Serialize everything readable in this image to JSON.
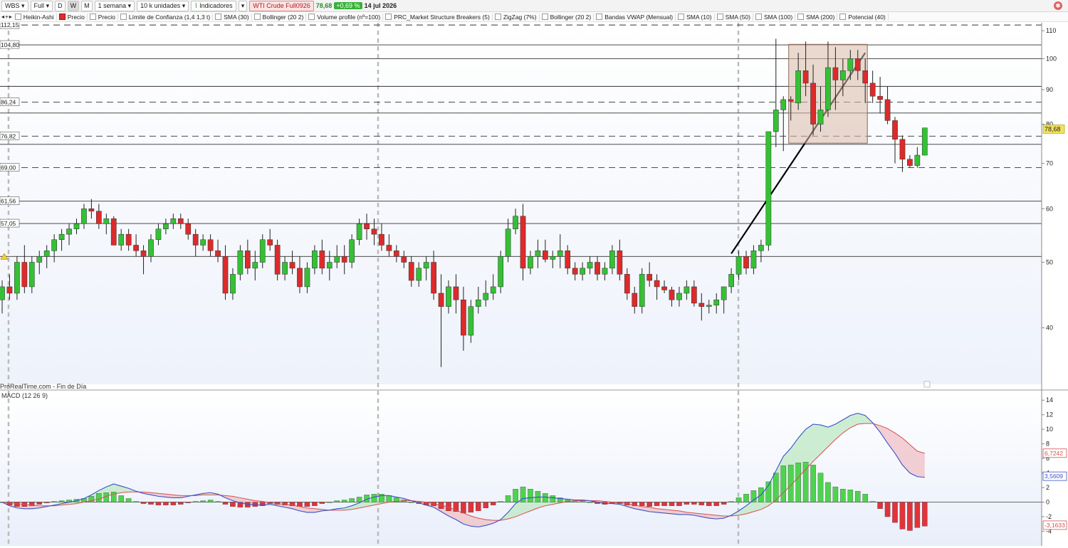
{
  "toolbar": {
    "ticker": "WBS",
    "mode": "Full",
    "periods": [
      "D",
      "W",
      "M"
    ],
    "interval": "1 semana",
    "units": "10 k unidades",
    "indicators": "Indicadores",
    "instrument": "WTI Crude Full0926",
    "price": "78,68",
    "change": "+0,69 %",
    "date": "14 jul 2026"
  },
  "legend": {
    "items": [
      "Heikin-Ashi",
      "Precio",
      "Precio",
      "Límite de Confianza (1,4 1,3 t)",
      "SMA (30)",
      "Bollinger (20 2)",
      "Volume profile (nº=100)",
      "PRC_Market Structure Breakers (5)",
      "ZigZag (7%)",
      "Bollinger (20 2)",
      "Bandas VWAP  (Mensual)",
      "SMA (10)",
      "SMA (50)",
      "SMA (100)",
      "SMA (200)",
      "Potencial (40)"
    ]
  },
  "footer": {
    "source": "ProRealTime.com - Fin de Día"
  },
  "macd_panel": {
    "title": "MACD (12 26 9)"
  },
  "colors": {
    "up": "#35c035",
    "down": "#dd2a2a",
    "macd_line": "#3a52c8",
    "signal_line": "#d65050",
    "level_line": "#333333"
  },
  "chart_data": [
    {
      "type": "candlestick",
      "title": "WTI Crude Full0926",
      "ylim": [
        33,
        113
      ],
      "y_ticks": [
        40,
        50,
        60,
        70,
        80,
        90,
        100,
        110
      ],
      "last_price_label": "78,68",
      "level_labels": [
        "112,15",
        "104,80",
        "86,24",
        "76,82",
        "69,00",
        "61,56",
        "57,05"
      ],
      "levels": [
        {
          "value": 112.15,
          "style": "dashed"
        },
        {
          "value": 104.8,
          "style": "solid"
        },
        {
          "value": 100,
          "style": "solid"
        },
        {
          "value": 91,
          "style": "solid"
        },
        {
          "value": 86.24,
          "style": "dashed"
        },
        {
          "value": 83.1,
          "style": "solid"
        },
        {
          "value": 76.82,
          "style": "dashed"
        },
        {
          "value": 74.7,
          "style": "solid"
        },
        {
          "value": 69.0,
          "style": "dashed"
        },
        {
          "value": 61.56,
          "style": "solid"
        },
        {
          "value": 57.05,
          "style": "solid"
        },
        {
          "value": 51.0,
          "style": "solid"
        }
      ],
      "candles": [
        [
          44,
          47,
          42,
          46
        ],
        [
          46,
          48,
          44,
          45
        ],
        [
          45,
          51,
          44,
          50
        ],
        [
          50,
          53,
          45,
          46
        ],
        [
          46,
          51,
          45,
          50
        ],
        [
          50,
          52,
          48,
          51
        ],
        [
          51,
          53,
          49,
          52
        ],
        [
          52,
          55,
          50,
          54
        ],
        [
          54,
          56,
          52,
          55
        ],
        [
          55,
          57,
          53,
          56
        ],
        [
          56,
          58,
          55,
          57
        ],
        [
          57,
          61,
          56,
          60
        ],
        [
          60,
          62,
          58,
          59.5
        ],
        [
          59.5,
          61,
          56,
          57
        ],
        [
          57,
          59,
          55,
          58
        ],
        [
          58,
          58.5,
          53,
          53
        ],
        [
          53,
          56,
          52,
          55
        ],
        [
          55,
          56,
          52,
          53
        ],
        [
          53,
          55,
          51,
          52
        ],
        [
          52,
          53,
          48,
          51
        ],
        [
          51,
          55,
          50,
          54
        ],
        [
          54,
          57,
          53,
          56
        ],
        [
          56,
          58,
          55,
          57
        ],
        [
          57,
          59,
          56,
          58
        ],
        [
          58,
          59,
          56,
          57
        ],
        [
          57,
          58,
          54,
          55
        ],
        [
          55,
          56,
          51,
          53
        ],
        [
          53,
          55,
          52,
          54
        ],
        [
          54,
          55,
          51,
          52
        ],
        [
          52,
          54,
          50,
          51
        ],
        [
          51,
          53,
          44,
          45
        ],
        [
          45,
          49,
          44,
          48
        ],
        [
          48,
          53,
          47,
          52
        ],
        [
          52,
          54,
          48,
          49
        ],
        [
          49,
          52,
          47,
          50
        ],
        [
          50,
          55,
          49,
          54
        ],
        [
          54,
          56,
          52,
          53
        ],
        [
          53,
          54,
          47,
          48
        ],
        [
          48,
          51,
          47,
          50
        ],
        [
          50,
          52,
          48,
          49
        ],
        [
          49,
          51,
          45,
          46
        ],
        [
          46,
          50,
          45,
          49
        ],
        [
          49,
          53,
          48,
          52
        ],
        [
          52,
          54,
          48,
          49
        ],
        [
          49,
          52,
          47,
          50
        ],
        [
          50,
          53,
          49,
          51
        ],
        [
          51,
          53,
          48,
          50
        ],
        [
          50,
          55,
          49,
          54
        ],
        [
          54,
          58,
          53,
          57
        ],
        [
          57,
          59,
          54,
          56
        ],
        [
          56,
          58,
          53,
          55
        ],
        [
          55,
          57,
          52,
          53
        ],
        [
          53,
          55,
          51,
          52
        ],
        [
          52,
          53,
          50,
          51
        ],
        [
          51,
          52,
          49,
          50
        ],
        [
          50,
          51,
          46,
          47
        ],
        [
          47,
          50,
          46,
          49
        ],
        [
          49,
          51,
          47,
          50
        ],
        [
          50,
          52,
          44,
          45
        ],
        [
          45,
          48,
          35,
          43
        ],
        [
          43,
          47,
          42,
          46
        ],
        [
          46,
          48,
          42,
          44
        ],
        [
          44,
          46,
          37,
          39
        ],
        [
          39,
          44,
          38,
          43
        ],
        [
          43,
          46,
          42,
          44
        ],
        [
          44,
          47,
          43,
          45
        ],
        [
          45,
          48,
          44,
          46
        ],
        [
          46,
          52,
          45,
          51
        ],
        [
          51,
          58,
          50,
          56
        ],
        [
          56,
          60,
          55,
          58.5
        ],
        [
          58.5,
          61,
          47,
          49
        ],
        [
          49,
          52,
          48,
          51
        ],
        [
          51,
          54,
          49,
          52
        ],
        [
          52,
          54,
          50,
          50.5
        ],
        [
          50.5,
          52,
          49,
          51
        ],
        [
          51,
          55,
          49,
          52
        ],
        [
          52,
          53,
          48,
          49
        ],
        [
          49,
          50,
          47,
          48
        ],
        [
          48,
          50,
          47,
          49
        ],
        [
          49,
          51,
          48,
          50
        ],
        [
          50,
          51,
          47,
          48
        ],
        [
          48,
          50,
          47,
          49
        ],
        [
          49,
          53,
          48,
          52
        ],
        [
          52,
          54,
          47,
          48
        ],
        [
          48,
          49,
          44,
          45
        ],
        [
          45,
          46,
          42,
          43
        ],
        [
          43,
          49,
          42,
          48
        ],
        [
          48,
          50,
          46,
          47
        ],
        [
          47,
          48,
          44,
          46
        ],
        [
          46,
          47,
          45,
          45.5
        ],
        [
          45.5,
          46,
          43,
          44
        ],
        [
          44,
          46,
          43,
          45
        ],
        [
          45,
          47,
          44,
          46
        ],
        [
          46,
          47,
          43,
          43.5
        ],
        [
          43.5,
          45,
          41,
          43
        ],
        [
          43,
          44,
          42,
          43.2
        ],
        [
          43.2,
          45,
          42,
          44
        ],
        [
          44,
          46,
          42,
          46
        ],
        [
          46,
          49,
          45,
          48
        ],
        [
          48,
          52,
          47,
          51
        ],
        [
          51,
          52,
          48,
          49
        ],
        [
          49,
          53,
          48,
          52
        ],
        [
          52,
          54,
          50,
          53
        ],
        [
          53,
          78,
          52,
          78
        ],
        [
          78,
          107,
          74,
          84
        ],
        [
          84,
          88,
          73,
          87
        ],
        [
          87,
          88,
          81,
          86.5
        ],
        [
          86,
          102,
          84,
          96
        ],
        [
          96,
          106,
          88,
          92
        ],
        [
          92,
          98,
          77,
          80
        ],
        [
          80,
          91,
          78,
          84
        ],
        [
          84,
          106,
          82,
          97
        ],
        [
          97,
          104,
          84,
          93
        ],
        [
          93,
          100,
          88,
          96
        ],
        [
          96,
          103,
          93,
          100
        ],
        [
          100,
          103,
          93,
          96
        ],
        [
          96,
          100,
          86,
          92
        ],
        [
          92,
          96,
          86,
          88
        ],
        [
          88,
          94,
          83,
          87
        ],
        [
          87,
          91,
          80,
          81
        ],
        [
          81,
          82,
          70,
          76
        ],
        [
          76,
          77,
          68,
          71
        ],
        [
          71,
          72,
          69,
          69.5
        ],
        [
          69.5,
          74,
          69,
          72
        ],
        [
          72,
          78,
          73,
          79
        ]
      ],
      "annotations": [
        {
          "type": "trendline",
          "from_candle": 98,
          "from_price": 51.5,
          "to_candle": 116,
          "to_price": 102
        },
        {
          "type": "rectangle",
          "from_candle": 106,
          "to_candle": 116,
          "top": 105,
          "bottom": 75
        }
      ]
    },
    {
      "type": "macd",
      "title": "MACD (12 26 9)",
      "ylim": [
        -6,
        15
      ],
      "y_ticks": [
        -4,
        -2,
        0,
        2,
        4,
        6,
        8,
        10,
        12,
        14
      ],
      "signal_value_label": "6,7242",
      "macd_value_label": "3,5609",
      "histogram_value_label": "-3,1633",
      "macd": [
        0,
        -0.5,
        -0.8,
        -0.9,
        -0.9,
        -0.8,
        -0.6,
        -0.4,
        -0.2,
        0,
        0.2,
        0.5,
        1.0,
        1.6,
        2.1,
        2.5,
        2.2,
        1.9,
        1.5,
        1.2,
        1.0,
        0.8,
        0.7,
        0.6,
        0.6,
        0.8,
        1.0,
        1.2,
        1.3,
        1.1,
        0.6,
        0.2,
        -0.1,
        -0.3,
        -0.4,
        -0.4,
        -0.3,
        -0.5,
        -0.7,
        -0.9,
        -1.2,
        -1.4,
        -1.4,
        -1.2,
        -1.1,
        -0.9,
        -0.8,
        -0.5,
        -0.1,
        0.4,
        0.7,
        0.9,
        0.9,
        0.7,
        0.5,
        0.2,
        -0.1,
        -0.4,
        -0.7,
        -1.3,
        -1.9,
        -2.4,
        -3.0,
        -3.3,
        -3.4,
        -3.2,
        -2.9,
        -2.4,
        -1.4,
        -0.2,
        0.5,
        0.6,
        0.7,
        0.7,
        0.6,
        0.5,
        0.4,
        0.3,
        0.3,
        0.2,
        0.0,
        -0.2,
        -0.2,
        -0.3,
        -0.6,
        -0.9,
        -1.1,
        -1.3,
        -1.4,
        -1.5,
        -1.6,
        -1.7,
        -1.7,
        -1.8,
        -2.0,
        -2.2,
        -2.3,
        -2.2,
        -1.8,
        -1.2,
        -0.5,
        0.3,
        1.0,
        2.3,
        4.3,
        6.3,
        7.4,
        8.8,
        10.0,
        10.7,
        10.6,
        10.3,
        10.7,
        11.3,
        11.9,
        12.2,
        11.9,
        10.9,
        9.6,
        8.1,
        6.7,
        5.1,
        4.0,
        3.5,
        3.4
      ],
      "signal": [
        0,
        -0.1,
        -0.2,
        -0.3,
        -0.4,
        -0.5,
        -0.5,
        -0.5,
        -0.4,
        -0.3,
        -0.2,
        0,
        0.2,
        0.4,
        0.8,
        1.1,
        1.3,
        1.4,
        1.4,
        1.4,
        1.3,
        1.2,
        1.1,
        1.0,
        0.9,
        0.9,
        0.9,
        1.0,
        1.0,
        1.0,
        0.9,
        0.8,
        0.6,
        0.4,
        0.2,
        0.1,
        -0.1,
        -0.2,
        -0.3,
        -0.4,
        -0.6,
        -0.8,
        -0.9,
        -1.0,
        -1.1,
        -1.1,
        -1.1,
        -1.0,
        -0.8,
        -0.6,
        -0.4,
        -0.2,
        0,
        0.1,
        0.2,
        0.2,
        0.1,
        0,
        -0.2,
        -0.4,
        -0.7,
        -1.1,
        -1.5,
        -1.9,
        -2.2,
        -2.4,
        -2.5,
        -2.5,
        -2.3,
        -2.0,
        -1.6,
        -1.2,
        -0.8,
        -0.5,
        -0.3,
        -0.1,
        0.1,
        0.2,
        0.2,
        0.2,
        0.2,
        0.1,
        0,
        -0.1,
        -0.2,
        -0.4,
        -0.6,
        -0.7,
        -0.9,
        -1.0,
        -1.1,
        -1.2,
        -1.4,
        -1.5,
        -1.6,
        -1.7,
        -1.8,
        -1.9,
        -1.9,
        -1.8,
        -1.6,
        -1.3,
        -1.0,
        -0.5,
        0.3,
        1.3,
        2.3,
        3.4,
        4.5,
        5.6,
        6.6,
        7.6,
        8.6,
        9.5,
        10.2,
        10.7,
        10.8,
        10.8,
        10.5,
        10.1,
        9.5,
        8.8,
        7.9,
        7.0,
        6.7
      ]
    }
  ]
}
